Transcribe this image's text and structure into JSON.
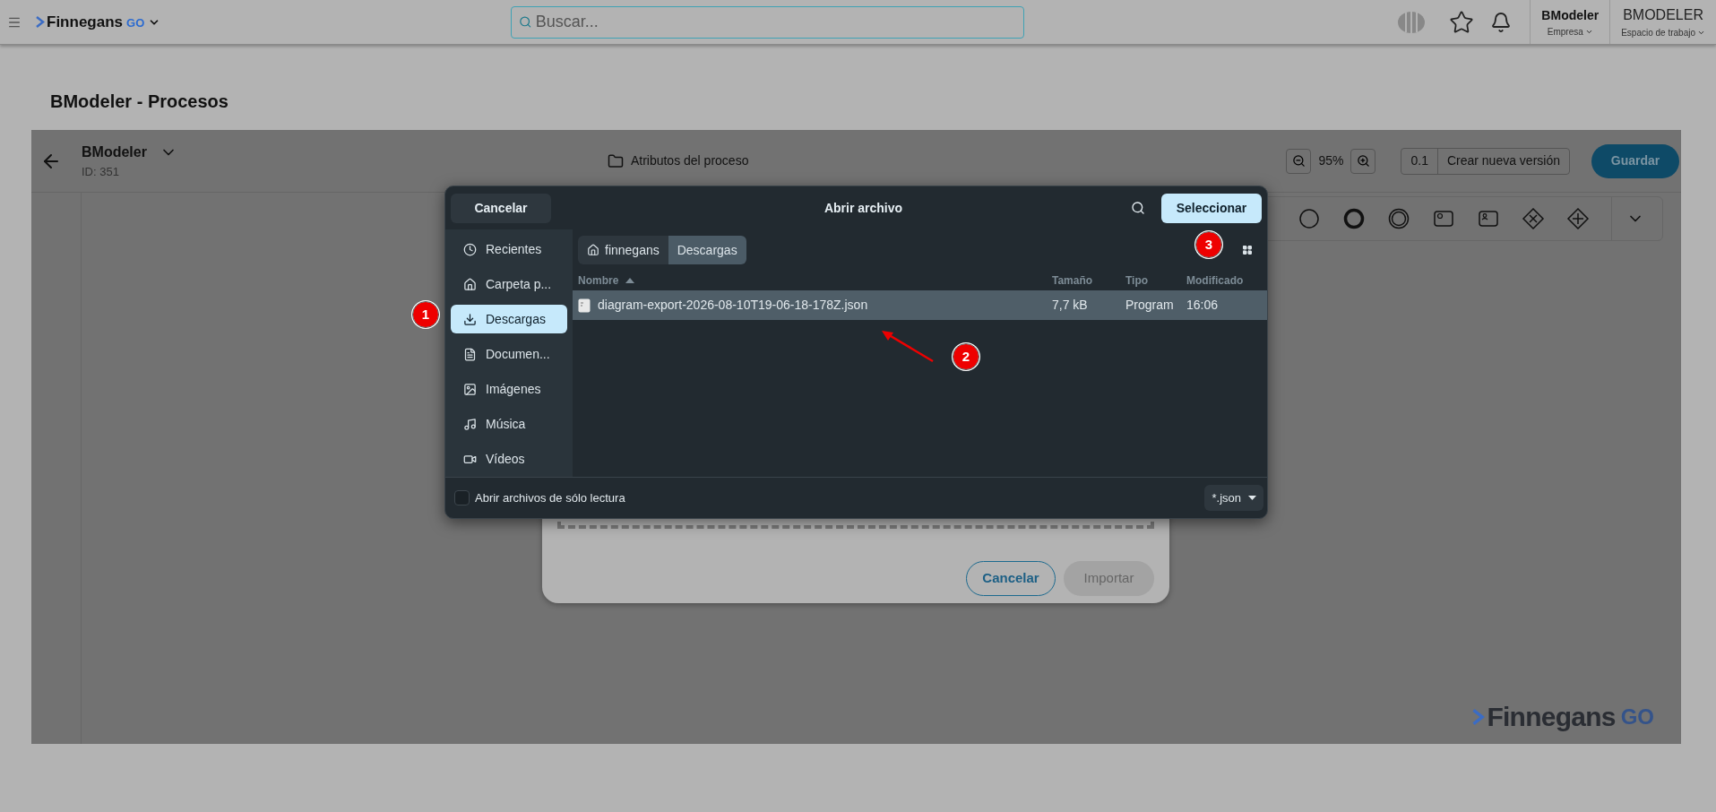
{
  "app_bar": {
    "brand": "Finnegans",
    "brand_suffix": "GO",
    "search": {
      "placeholder": "Buscar..."
    },
    "company": {
      "name": "BModeler",
      "caption": "Empresa"
    },
    "workspace": {
      "name": "BMODELER",
      "caption": "Espacio de trabajo"
    }
  },
  "page_title": "BModeler - Procesos",
  "editor": {
    "process_name": "BModeler",
    "process_id": "ID: 351",
    "attributes_link": "Atributos del proceso",
    "zoom": "95%",
    "version": "0.1",
    "new_version_button": "Crear nueva versión",
    "save_button": "Guardar",
    "palette": [
      {
        "kind": "circle"
      },
      {
        "kind": "thick-circle"
      },
      {
        "kind": "double-circle"
      },
      {
        "kind": "task-gear"
      },
      {
        "kind": "task-user"
      },
      {
        "kind": "gateway-x"
      },
      {
        "kind": "gateway-plus"
      }
    ]
  },
  "footer_logo": {
    "brand": "Finnegans",
    "suffix": "GO"
  },
  "import_dialog": {
    "buttons": [
      {
        "label": "Cancelar",
        "kind": "outline"
      },
      {
        "label": "Importar",
        "kind": "disabled"
      }
    ]
  },
  "file_dialog": {
    "title": "Abrir archivo",
    "cancel_button": "Cancelar",
    "select_button": "Seleccionar",
    "places": [
      {
        "label": "Recientes",
        "selected": false
      },
      {
        "label": "Carpeta p...",
        "selected": false
      },
      {
        "label": "Descargas",
        "selected": true
      },
      {
        "label": "Documen...",
        "selected": false
      },
      {
        "label": "Imágenes",
        "selected": false
      },
      {
        "label": "Música",
        "selected": false
      },
      {
        "label": "Vídeos",
        "selected": false
      }
    ],
    "path": [
      {
        "label": "finnegans",
        "selected": false
      },
      {
        "label": "Descargas",
        "selected": true
      }
    ],
    "columns": [
      "Nombre",
      "Tamaño",
      "Tipo",
      "Modificado"
    ],
    "files": [
      {
        "name": "diagram-export-2026-08-10T19-06-18-178Z.json",
        "size": "7,7 kB",
        "type": "Program",
        "modified": "16:06",
        "selected": true
      }
    ],
    "readonly_option": {
      "label": "Abrir archivos de sólo lectura",
      "checked": false
    },
    "filter": "*.json"
  },
  "annotations": [
    {
      "label": "1"
    },
    {
      "label": "2"
    },
    {
      "label": "3"
    }
  ]
}
